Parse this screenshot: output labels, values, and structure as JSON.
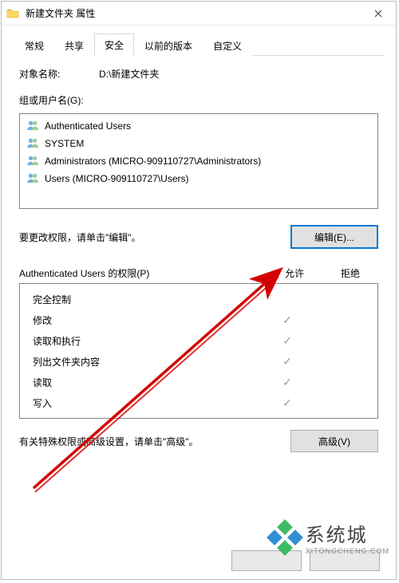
{
  "window": {
    "title": "新建文件夹 属性"
  },
  "tabs": {
    "t0": "常规",
    "t1": "共享",
    "t2": "安全",
    "t3": "以前的版本",
    "t4": "自定义"
  },
  "object": {
    "label": "对象名称:",
    "value": "D:\\新建文件夹"
  },
  "group_users": {
    "label": "组或用户名(G):",
    "items": {
      "i0": "Authenticated Users",
      "i1": "SYSTEM",
      "i2": "Administrators (MICRO-909110727\\Administrators)",
      "i3": "Users (MICRO-909110727\\Users)"
    }
  },
  "edit_hint": "要更改权限，请单击\"编辑\"。",
  "edit_button": "编辑(E)...",
  "permissions": {
    "title": "Authenticated Users 的权限(P)",
    "col_allow": "允许",
    "col_deny": "拒绝",
    "rows": {
      "r0": {
        "name": "完全控制",
        "allow": false,
        "deny": false
      },
      "r1": {
        "name": "修改",
        "allow": true,
        "deny": false
      },
      "r2": {
        "name": "读取和执行",
        "allow": true,
        "deny": false
      },
      "r3": {
        "name": "列出文件夹内容",
        "allow": true,
        "deny": false
      },
      "r4": {
        "name": "读取",
        "allow": true,
        "deny": false
      },
      "r5": {
        "name": "写入",
        "allow": true,
        "deny": false
      }
    }
  },
  "advanced": {
    "hint": "有关特殊权限或高级设置，请单击\"高级\"。",
    "button": "高级(V)"
  },
  "watermark": {
    "text": "系统城",
    "sub": "XITONGCHENG.COM"
  }
}
